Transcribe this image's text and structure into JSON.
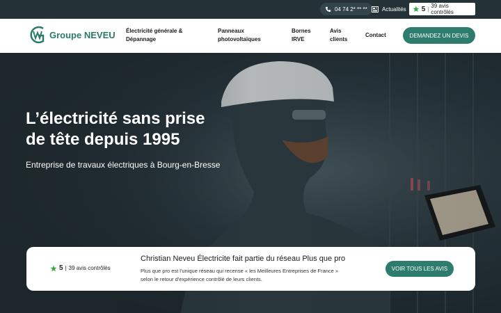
{
  "topbar": {
    "phone": "04 74 2* ** **",
    "news_label": "Actualités",
    "rating_score": "5",
    "rating_separator": "|",
    "rating_count": "39 avis contrôlés"
  },
  "header": {
    "logo_text": "Groupe NEVEU",
    "nav": [
      {
        "label_line1": "Électricité générale &",
        "label_line2": "Dépannage"
      },
      {
        "label_line1": "Panneaux",
        "label_line2": "photovoltaïques"
      },
      {
        "label_line1": "Bornes",
        "label_line2": "IRVE"
      },
      {
        "label_line1": "Avis",
        "label_line2": "clients"
      },
      {
        "label_line1": "Contact",
        "label_line2": ""
      }
    ],
    "cta_label": "DEMANDEZ UN DEVIS"
  },
  "hero": {
    "title_line1": "L’électricité sans prise",
    "title_line2": "de tête depuis 1995",
    "subtitle": "Entreprise de travaux électriques à Bourg-en-Bresse"
  },
  "review_card": {
    "rating_score": "5",
    "rating_separator": "|",
    "rating_count": "39 avis contrôlés",
    "title": "Christian Neveu Électricite fait partie du réseau Plus que pro",
    "desc_line1": "Plus que pro est l'unique réseau qui recense « les Meilleures Entreprises de France »",
    "desc_line2": "selon le retour d'expérience contrôlé de leurs clients.",
    "button_label": "VOIR TOUS LES AVIS"
  },
  "colors": {
    "brand_green": "#2e7c6d",
    "topbar_bg": "#243238",
    "star_green": "#3aa84a"
  },
  "icons": [
    "phone-icon",
    "newspaper-icon",
    "star-icon",
    "logo-mark-icon"
  ]
}
